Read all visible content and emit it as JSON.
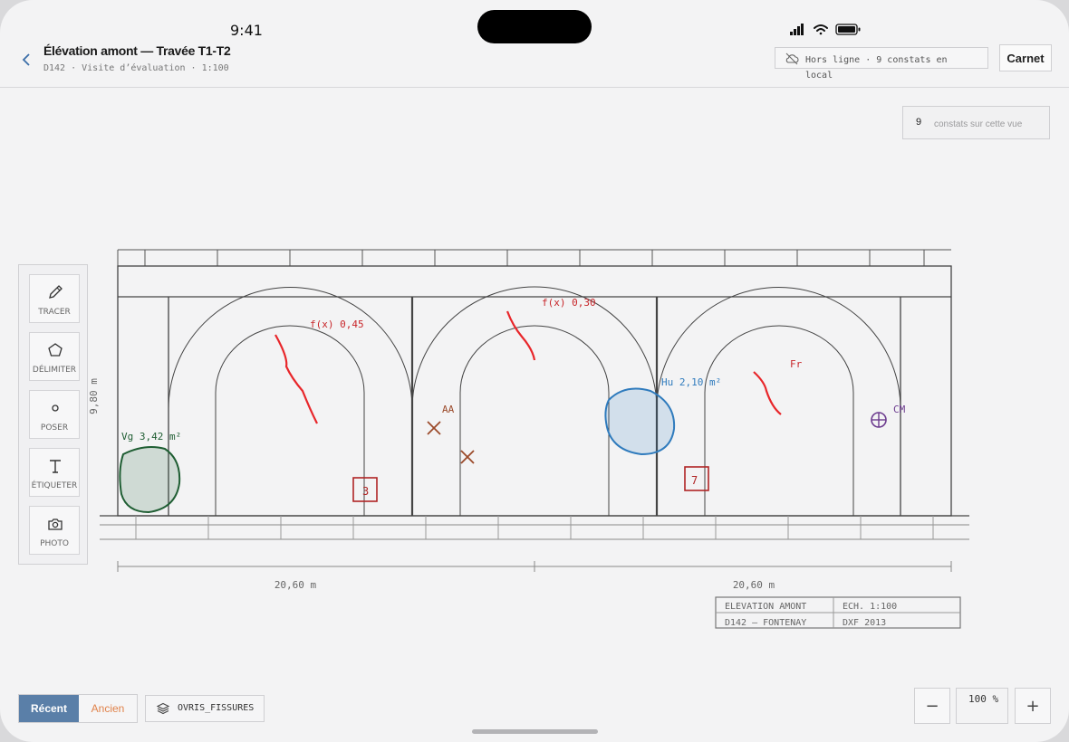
{
  "status_bar": {
    "time": "9:41"
  },
  "header": {
    "title": "Élévation amont — Travée T1-T2",
    "subtitle": "D142 · Visite d’évaluation · 1:100",
    "offline_text": "Hors ligne · 9 constats en local",
    "carnet_label": "Carnet"
  },
  "count": {
    "value": "9",
    "label": "constats sur cette vue"
  },
  "tools": [
    {
      "label": "TRACER",
      "icon": "pencil-icon"
    },
    {
      "label": "DÉLIMITER",
      "icon": "pentagon-icon"
    },
    {
      "label": "POSER",
      "icon": "point-icon"
    },
    {
      "label": "ÉTIQUETER",
      "icon": "text-icon"
    },
    {
      "label": "PHOTO",
      "icon": "camera-icon"
    }
  ],
  "drawing": {
    "height_label": "9,80 m",
    "span_left": "20,60 m",
    "span_right": "20,60 m",
    "annotations": {
      "crack1": "f(x) 0,45",
      "crack2": "f(x) 0,30",
      "crack3": "Fr",
      "vegetation": "Vg 3,42 m²",
      "humidity": "Hu 2,10 m²",
      "aa": "AA",
      "cm": "CM",
      "box1": "3",
      "box2": "7"
    },
    "cartouche": {
      "r1c1": "ELEVATION AMONT",
      "r1c2": "ECH. 1:100",
      "r2c1": "D142 — FONTENAY",
      "r2c2": "DXF 2013"
    },
    "colors": {
      "crack": "#e8262a",
      "vegetation": "#1f5e33",
      "humidity": "#2f7bbd",
      "aa": "#9b4a2a",
      "cm": "#6b3a8e",
      "box": "#b02424"
    }
  },
  "bottom": {
    "recent_label": "Récent",
    "old_label": "Ancien",
    "layer_label": "OVRIS_FISSURES",
    "zoom_out": "−",
    "zoom_value": "100 %",
    "zoom_in": "+"
  }
}
